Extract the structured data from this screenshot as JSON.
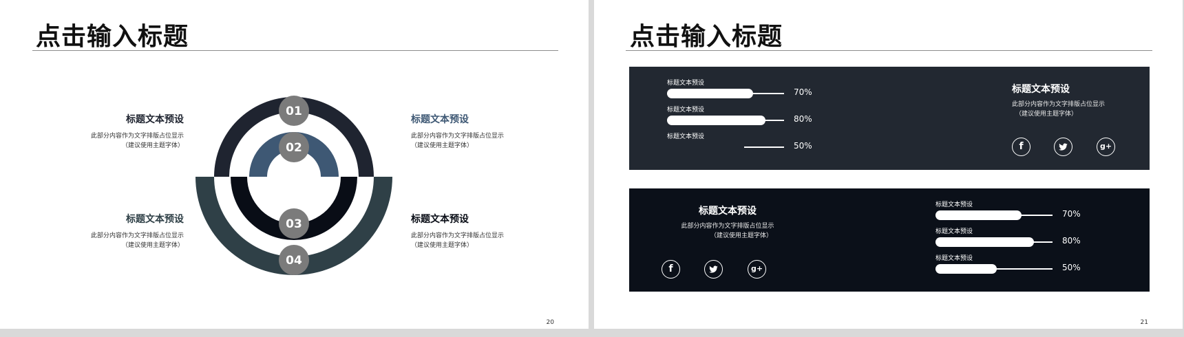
{
  "slides": [
    {
      "title": "点击输入标题",
      "page_number": "20",
      "steps": [
        "01",
        "02",
        "03",
        "04"
      ],
      "colors": {
        "ring1": "#1f2430",
        "ring2": "#3e5874",
        "ring3": "#090d16",
        "ring4": "#2f4047",
        "badge": "#7b7b7b"
      },
      "items": [
        {
          "heading": "标题文本预设",
          "line1": "此部分内容作为文字排版占位显示",
          "line2": "（建议使用主题字体）",
          "heading_color": "#1f2430"
        },
        {
          "heading": "标题文本预设",
          "line1": "此部分内容作为文字排版占位显示",
          "line2": "（建议使用主题字体）",
          "heading_color": "#3e5874"
        },
        {
          "heading": "标题文本预设",
          "line1": "此部分内容作为文字排版占位显示",
          "line2": "（建议使用主题字体）",
          "heading_color": "#2f4047"
        },
        {
          "heading": "标题文本预设",
          "line1": "此部分内容作为文字排版占位显示",
          "line2": "（建议使用主题字体）",
          "heading_color": "#090d16"
        }
      ]
    },
    {
      "title": "点击输入标题",
      "page_number": "21",
      "top_panel": {
        "bars": [
          {
            "label": "标题文本预设",
            "percent": "70%",
            "value": 0.7
          },
          {
            "label": "标题文本预设",
            "percent": "80%",
            "value": 0.8
          },
          {
            "label": "标题文本预设",
            "percent": "50%",
            "value": 0.5
          }
        ],
        "heading": "标题文本预设",
        "line1": "此部分内容作为文字排版占位显示",
        "line2": "（建议使用主题字体）",
        "social": [
          "facebook-icon",
          "twitter-icon",
          "google-plus-icon"
        ]
      },
      "bottom_panel": {
        "heading": "标题文本预设",
        "line1": "此部分内容作为文字排版占位显示",
        "line2": "（建议使用主题字体）",
        "bars": [
          {
            "label": "标题文本预设",
            "percent": "70%",
            "value": 0.7
          },
          {
            "label": "标题文本预设",
            "percent": "80%",
            "value": 0.8
          },
          {
            "label": "标题文本预设",
            "percent": "50%",
            "value": 0.5
          }
        ],
        "social": [
          "facebook-icon",
          "twitter-icon",
          "google-plus-icon"
        ]
      }
    }
  ]
}
